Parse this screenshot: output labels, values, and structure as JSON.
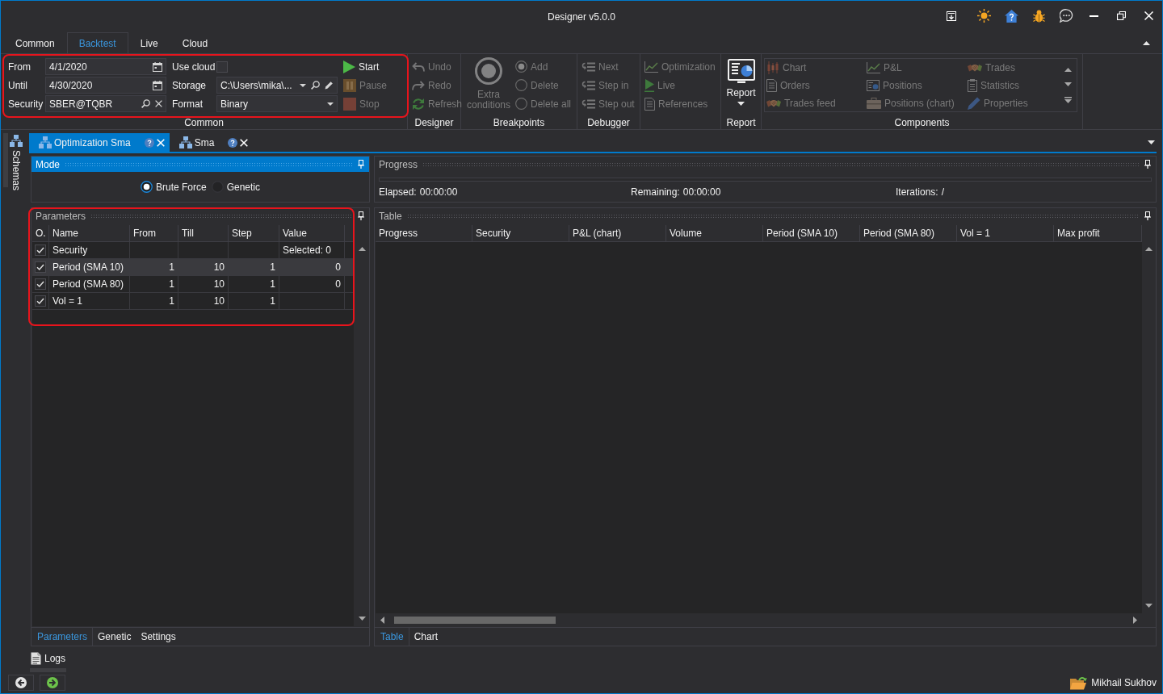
{
  "window": {
    "title": "Designer v5.0.0"
  },
  "ribbon": {
    "tabs": [
      {
        "label": "Common",
        "selected": false
      },
      {
        "label": "Backtest",
        "selected": true
      },
      {
        "label": "Live",
        "selected": false
      },
      {
        "label": "Cloud",
        "selected": false
      }
    ],
    "common": {
      "label": "Common",
      "highlighted": true,
      "from": {
        "label": "From",
        "value": "4/1/2020"
      },
      "until": {
        "label": "Until",
        "value": "4/30/2020"
      },
      "security": {
        "label": "Security",
        "value": "SBER@TQBR"
      },
      "use_cloud": {
        "label": "Use cloud",
        "checked": false
      },
      "storage": {
        "label": "Storage",
        "value": "C:\\Users\\mika\\..."
      },
      "format": {
        "label": "Format",
        "value": "Binary"
      },
      "actions": [
        {
          "label": "Start",
          "disabled": false
        },
        {
          "label": "Pause",
          "disabled": true
        },
        {
          "label": "Stop",
          "disabled": true
        }
      ]
    },
    "designer": {
      "label": "Designer",
      "actions": [
        {
          "label": "Undo",
          "disabled": true
        },
        {
          "label": "Redo",
          "disabled": true
        },
        {
          "label": "Refresh",
          "disabled": true
        }
      ]
    },
    "breakpoints": {
      "label": "Breakpoints",
      "extra_conditions": {
        "label": "Extra conditions",
        "disabled": true
      },
      "options": [
        {
          "label": "Add",
          "selected": true,
          "disabled": true
        },
        {
          "label": "Delete",
          "selected": false,
          "disabled": true
        },
        {
          "label": "Delete all",
          "selected": false,
          "disabled": true
        }
      ]
    },
    "debugger": {
      "label": "Debugger",
      "actions": [
        {
          "label": "Next",
          "disabled": true
        },
        {
          "label": "Step in",
          "disabled": true
        },
        {
          "label": "Step out",
          "disabled": true
        }
      ]
    },
    "tools": {
      "actions": [
        {
          "label": "Optimization",
          "disabled": true
        },
        {
          "label": "Live",
          "disabled": true
        },
        {
          "label": "References",
          "disabled": true
        }
      ]
    },
    "report": {
      "label": "Report",
      "button": {
        "label": "Report",
        "disabled": false
      }
    },
    "components": {
      "label": "Components",
      "items": [
        {
          "label": "Chart",
          "disabled": true
        },
        {
          "label": "P&L",
          "disabled": true
        },
        {
          "label": "Trades",
          "disabled": true
        },
        {
          "label": "Orders",
          "disabled": true
        },
        {
          "label": "Positions",
          "disabled": true
        },
        {
          "label": "Statistics",
          "disabled": true
        },
        {
          "label": "Trades feed",
          "disabled": true
        },
        {
          "label": "Positions (chart)",
          "disabled": true
        },
        {
          "label": "Properties",
          "disabled": true
        }
      ]
    }
  },
  "side_panel": {
    "label": "Schemas"
  },
  "document_tabs": [
    {
      "label": "Optimization Sma",
      "selected": true
    },
    {
      "label": "Sma",
      "selected": false
    }
  ],
  "mode": {
    "title": "Mode",
    "active": true,
    "options": [
      {
        "label": "Brute Force",
        "selected": true
      },
      {
        "label": "Genetic",
        "selected": false
      }
    ]
  },
  "parameters": {
    "title": "Parameters",
    "active": false,
    "highlighted": true,
    "columns": [
      "O.",
      "Name",
      "From",
      "Till",
      "Step",
      "Value"
    ],
    "rows": [
      {
        "kind": "security",
        "checked": true,
        "selected": false,
        "name": "Security",
        "value": "Selected: 0"
      },
      {
        "kind": "range",
        "checked": true,
        "selected": true,
        "name": "Period (SMA 10)",
        "from": "1",
        "till": "10",
        "step": "1",
        "value": "0"
      },
      {
        "kind": "range",
        "checked": true,
        "selected": false,
        "name": "Period (SMA 80)",
        "from": "1",
        "till": "10",
        "step": "1",
        "value": "0"
      },
      {
        "kind": "range",
        "checked": true,
        "selected": false,
        "name": "Vol = 1",
        "from": "1",
        "till": "10",
        "step": "1"
      }
    ]
  },
  "left_tabs": [
    {
      "label": "Parameters",
      "selected": true
    },
    {
      "label": "Genetic",
      "selected": false
    },
    {
      "label": "Settings",
      "selected": false
    }
  ],
  "progress": {
    "title": "Progress",
    "active": false,
    "stats": [
      {
        "label": "Elapsed:",
        "value": "00:00:00"
      },
      {
        "label": "Remaining:",
        "value": "00:00:00"
      },
      {
        "label": "Iterations:",
        "value": "/"
      }
    ]
  },
  "results_table": {
    "title": "Table",
    "active": false,
    "columns": [
      "Progress",
      "Security",
      "P&L (chart)",
      "Volume",
      "Period (SMA 10)",
      "Period (SMA 80)",
      "Vol = 1",
      "Max profit"
    ]
  },
  "right_tabs": [
    {
      "label": "Table",
      "selected": true
    },
    {
      "label": "Chart",
      "selected": false
    }
  ],
  "logs": {
    "label": "Logs"
  },
  "user": {
    "name": "Mikhail Sukhov"
  }
}
